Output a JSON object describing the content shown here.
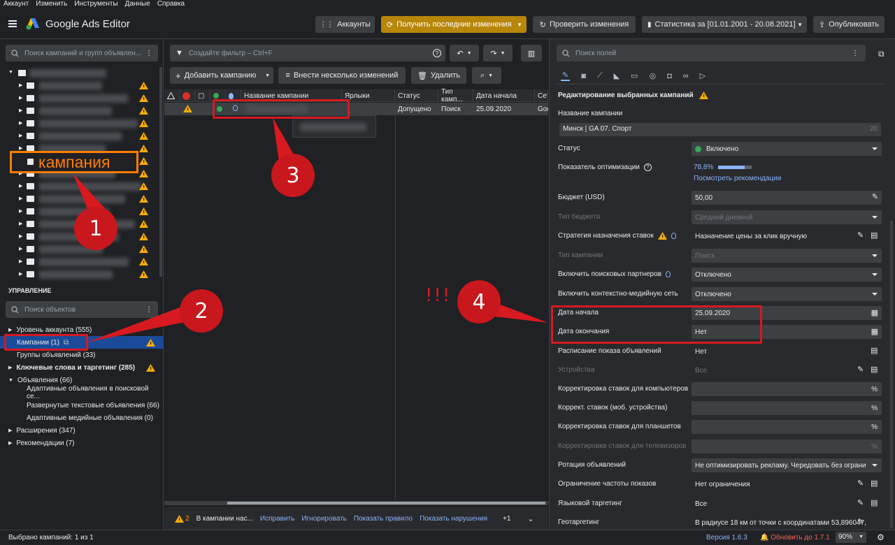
{
  "menu": [
    "Аккаунт",
    "Изменить",
    "Инструменты",
    "Данные",
    "Справка"
  ],
  "app": {
    "title": "Google Ads Editor"
  },
  "toolbar": {
    "accounts": "Аккаунты",
    "get_changes": "Получить последние изменения",
    "check_changes": "Проверить изменения",
    "stats": "Статистика за [01.01.2001 - 20.08.2021]",
    "publish": "Опубликовать"
  },
  "left": {
    "search_placeholder": "Поиск кампаний и групп объявлен...",
    "campaign_callout": "кампания",
    "section_title": "УПРАВЛЕНИЕ",
    "objects_placeholder": "Поиск объектов",
    "nav": [
      {
        "label": "Уровень аккаунта (555)"
      },
      {
        "label": "Кампании (1)"
      },
      {
        "label": "Группы объявлений (33)"
      },
      {
        "label": "Ключевые слова и таргетинг (285)"
      },
      {
        "label": "Объявления (66)"
      },
      {
        "label": "Адаптивные объявления в поисковой се..."
      },
      {
        "label": "Развернутые текстовые объявления (66)"
      },
      {
        "label": "Адаптивные медийные объявления (0)"
      },
      {
        "label": "Расширения (347)"
      },
      {
        "label": "Рекомендации (7)"
      }
    ]
  },
  "middle": {
    "filter_placeholder": "Создайте фильтр – Ctrl+F",
    "add_campaign": "Добавить кампанию",
    "multi_changes": "Внести несколько изменений",
    "delete": "Удалить",
    "columns": [
      "Название кампании",
      "Ярлыки",
      "Статус",
      "Тип камп...",
      "Дата начала",
      "Сет"
    ],
    "row": {
      "status": "Допущено",
      "type": "Поиск",
      "start": "25.09.2020",
      "net": "Goo"
    },
    "bottom": {
      "count": "2",
      "text": "В кампании нас...",
      "fix": "Исправить",
      "ignore": "Игнорировать",
      "show_rule": "Показать правило",
      "show_violations": "Показать нарушения",
      "more": "+1"
    }
  },
  "right": {
    "search_placeholder": "Поиск полей",
    "section_title": "Редактирование выбранных кампаний",
    "name_label": "Название кампании",
    "name_value": "Минск | GA 07. Спорт",
    "name_count": "20",
    "fields": [
      {
        "label": "Статус",
        "value": "Включено"
      },
      {
        "label": "Показатель оптимизации",
        "value": "78,8%",
        "link": "Посмотреть рекомендации",
        "level": 0.788
      },
      {
        "label": "Бюджет (USD)",
        "value": "50,00"
      },
      {
        "label": "Тип бюджета",
        "value": "Средний дневной"
      },
      {
        "label": "Стратегия назначения ставок",
        "value": "Назначение цены за клик вручную"
      },
      {
        "label": "Тип кампании",
        "value": "Поиск"
      },
      {
        "label": "Включить поисковых партнеров",
        "value": "Отключено"
      },
      {
        "label": "Включить контекстно-медийную сеть",
        "value": "Отключено"
      },
      {
        "label": "Дата начала",
        "value": "25.09.2020"
      },
      {
        "label": "Дата окончания",
        "value": "Нет"
      },
      {
        "label": "Расписание показа объявлений",
        "value": "Нет"
      },
      {
        "label": "Устройства",
        "value": "Все"
      },
      {
        "label": "Корректировка ставок для компьютеров",
        "value": "%"
      },
      {
        "label": "Коррект. ставок (моб. устройства)",
        "value": "%"
      },
      {
        "label": "Корректировка ставок для планшетов",
        "value": "%"
      },
      {
        "label": "Корректировка ставок для телевизоров",
        "value": "%"
      },
      {
        "label": "Ротация объявлений",
        "value": "Не оптимизировать рекламу. Чередовать без ограничен"
      },
      {
        "label": "Ограничение частоты показов",
        "value": "Нет ограничения"
      },
      {
        "label": "Языковой таргетинг",
        "value": "Все"
      },
      {
        "label": "Геотаргетинг",
        "value": "В радиусе 18 км от точки с координатами 53,896047, ..."
      }
    ]
  },
  "annotations": {
    "b1": "1",
    "b2": "2",
    "b3": "3",
    "b4": "4",
    "exclaim": "!!!"
  },
  "status": {
    "selected": "Выбрано кампаний: 1 из 1",
    "version": "Версия 1.6.3",
    "update": "Обновить до 1.7.1",
    "zoom": "90%"
  },
  "colors": {
    "accent": "#8ab4f8",
    "amber": "#b8860b",
    "warn": "#f9ab00",
    "annot_red": "#c8171d",
    "callout": "#ff7d00"
  }
}
